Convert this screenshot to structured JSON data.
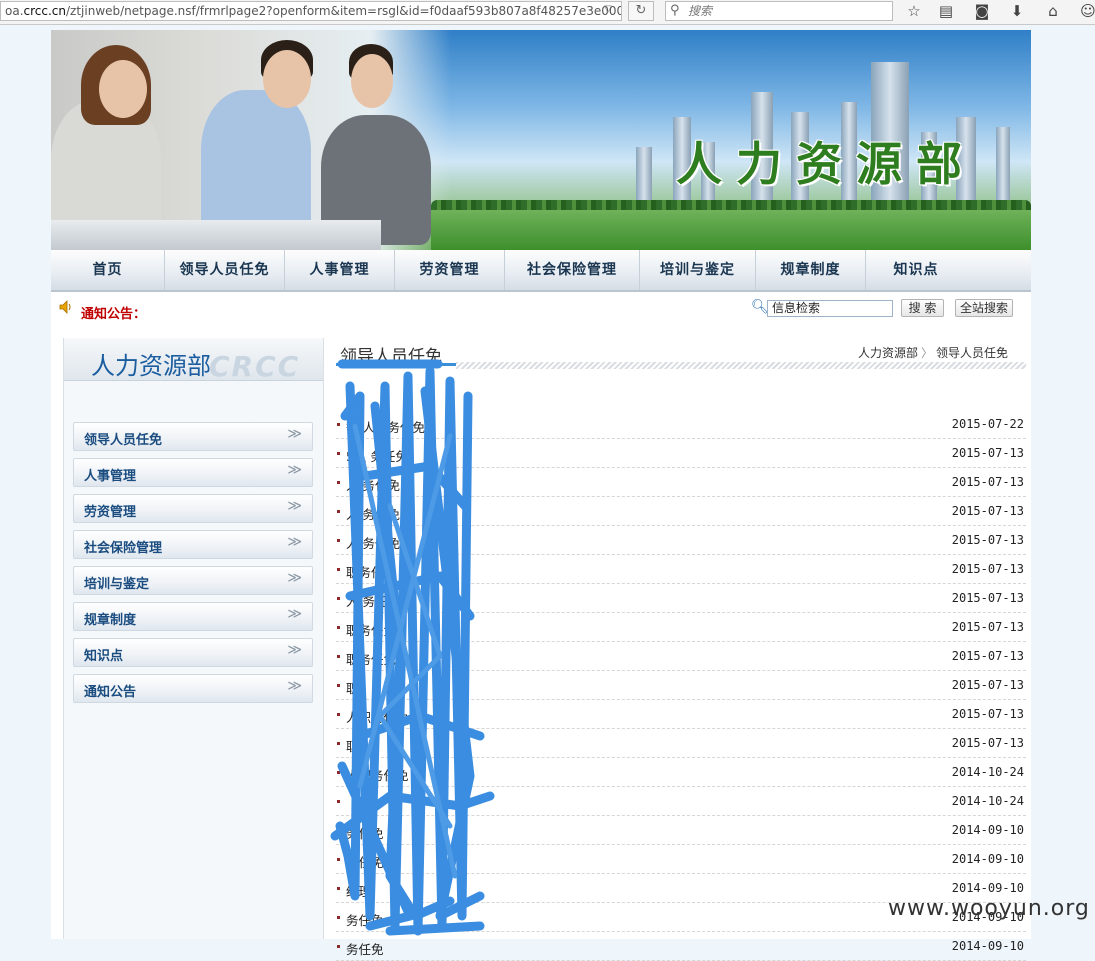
{
  "browser": {
    "url_prefix": "oa.",
    "url_domain": "crcc.cn",
    "url_rest": "/ztjinweb/netpage.nsf/frmrlpage2?openform&item=rsgl&id=f0daaf593b807a8f48257e3e000",
    "search_placeholder": "搜索"
  },
  "banner": {
    "title": "人力资源部"
  },
  "nav": {
    "items": [
      "首页",
      "领导人员任免",
      "人事管理",
      "劳资管理",
      "社会保险管理",
      "培训与鉴定",
      "规章制度",
      "知识点"
    ]
  },
  "notice": {
    "label": "通知公告："
  },
  "site_search": {
    "input_value": "信息检索",
    "search_button": "搜 索",
    "site_search_button": "全站搜索"
  },
  "sidebar": {
    "title": "人力资源部",
    "watermark": "CRCC",
    "items": [
      "领导人员任免",
      "人事管理",
      "劳资管理",
      "社会保险管理",
      "培训与鉴定",
      "规章制度",
      "知识点",
      "通知公告"
    ]
  },
  "main": {
    "title": "领导人员任免",
    "breadcrumb": [
      "人力资源部",
      "领导人员任免"
    ],
    "rows": [
      {
        "title": "等  人职务任免",
        "date": "2015-07-22"
      },
      {
        "title": "5人  务任免",
        "date": "2015-07-13"
      },
      {
        "title": "人  务任免",
        "date": "2015-07-13"
      },
      {
        "title": "人  务任免",
        "date": "2015-07-13"
      },
      {
        "title": "人  务任免",
        "date": "2015-07-13"
      },
      {
        "title": "职务任免",
        "date": "2015-07-13"
      },
      {
        "title": "人  务任免",
        "date": "2015-07-13"
      },
      {
        "title": "职务任免",
        "date": "2015-07-13"
      },
      {
        "title": "职务任免",
        "date": "2015-07-13"
      },
      {
        "title": "职",
        "date": "2015-07-13"
      },
      {
        "title": "人职务任免",
        "date": "2015-07-13"
      },
      {
        "title": "职",
        "date": "2015-07-13"
      },
      {
        "title": "人职务任免",
        "date": "2014-10-24"
      },
      {
        "title": "",
        "date": "2014-10-24"
      },
      {
        "title": "务任免",
        "date": "2014-09-10"
      },
      {
        "title": "务任免",
        "date": "2014-09-10"
      },
      {
        "title": "经理",
        "date": "2014-09-10"
      },
      {
        "title": "务任免",
        "date": "2014-09-10"
      },
      {
        "title": "务任免",
        "date": "2014-09-10"
      }
    ]
  },
  "watermark": "www.wooyun.org"
}
